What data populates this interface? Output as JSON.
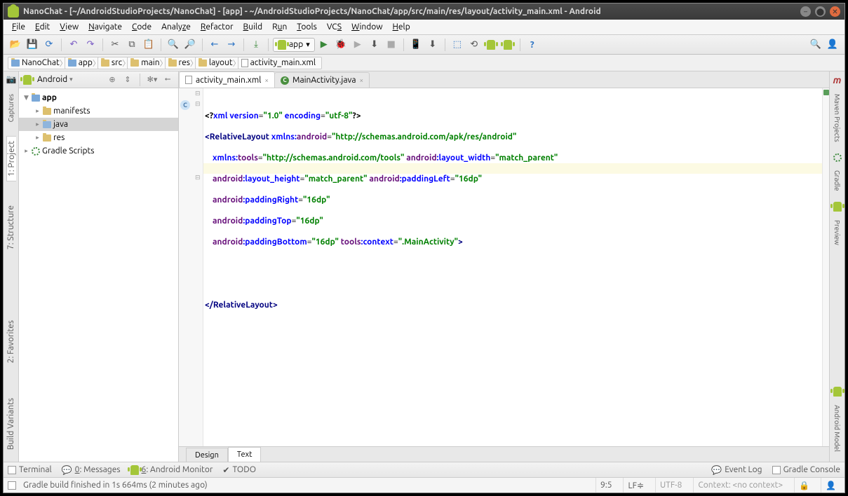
{
  "title": "NanoChat - [~/AndroidStudioProjects/NanoChat] - [app] - ~/AndroidStudioProjects/NanoChat/app/src/main/res/layout/activity_main.xml - Android",
  "menu": {
    "file": "File",
    "edit": "Edit",
    "view": "View",
    "navigate": "Navigate",
    "code": "Code",
    "analyze": "Analyze",
    "refactor": "Refactor",
    "build": "Build",
    "run": "Run",
    "tools": "Tools",
    "vcs": "VCS",
    "window": "Window",
    "help": "Help"
  },
  "run_config": "app",
  "breadcrumb": [
    "NanoChat",
    "app",
    "src",
    "main",
    "res",
    "layout",
    "activity_main.xml"
  ],
  "project_header": "Android",
  "tree": {
    "root": "app",
    "manifests": "manifests",
    "java": "java",
    "res": "res",
    "gradle": "Gradle Scripts"
  },
  "tabs": {
    "t1": "activity_main.xml",
    "t2": "MainActivity.java"
  },
  "editor_bottom": {
    "design": "Design",
    "text": "Text"
  },
  "left_tools": {
    "captures": "Captures",
    "project": "1: Project",
    "structure": "7: Structure",
    "favorites": "2: Favorites",
    "variants": "Build Variants"
  },
  "right_tools": {
    "maven": "Maven Projects",
    "gradle": "Gradle",
    "preview": "Preview",
    "model": "Android Model"
  },
  "bottom_tools": {
    "terminal": "Terminal",
    "messages": "0: Messages",
    "monitor": "6: Android Monitor",
    "todo": "TODO",
    "eventlog": "Event Log",
    "gradlec": "Gradle Console"
  },
  "status": {
    "msg": "Gradle build finished in 1s 664ms (2 minutes ago)",
    "pos": "9:5",
    "le": "LF≑",
    "enc": "UTF-8",
    "ctx": "Context: <no context>"
  },
  "code": {
    "l1a": "<?",
    "l1b": "xml version",
    "l1c": "=",
    "l1d": "\"1.0\"",
    "l1e": " encoding",
    "l1f": "=",
    "l1g": "\"utf-8\"",
    "l1h": "?>",
    "l2a": "<",
    "l2b": "RelativeLayout ",
    "l2c": "xmlns:",
    "l2d": "android",
    "l2e": "=",
    "l2f": "\"http://schemas.android.com/apk/res/android\"",
    "l3a": "xmlns:",
    "l3b": "tools",
    "l3c": "=",
    "l3d": "\"http://schemas.android.com/tools\"",
    "l3e": " android",
    "l3f": ":layout_width",
    "l3g": "=",
    "l3h": "\"match_parent\"",
    "l4a": "android",
    "l4b": ":layout_height",
    "l4c": "=",
    "l4d": "\"match_parent\"",
    "l4e": " android",
    "l4f": ":paddingLeft",
    "l4g": "=",
    "l4h": "\"16dp\"",
    "l5a": "android",
    "l5b": ":paddingRight",
    "l5c": "=",
    "l5d": "\"16dp\"",
    "l6a": "android",
    "l6b": ":paddingTop",
    "l6c": "=",
    "l6d": "\"16dp\"",
    "l7a": "android",
    "l7b": ":paddingBottom",
    "l7c": "=",
    "l7d": "\"16dp\"",
    "l7e": " tools",
    "l7f": ":context",
    "l7g": "=",
    "l7h": "\".MainActivity\"",
    "l7i": ">",
    "l9a": "</",
    "l9b": "RelativeLayout",
    "l9c": ">"
  }
}
